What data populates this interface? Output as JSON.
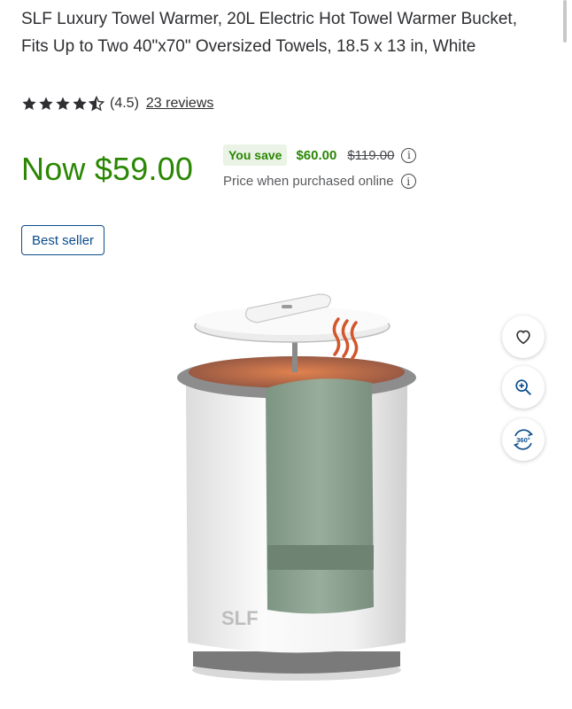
{
  "product": {
    "title": "SLF Luxury Towel Warmer, 20L Electric Hot Towel Warmer Bucket, Fits Up to Two 40\"x70\" Oversized Towels, 18.5 x 13 in, White",
    "rating_value": 4.5,
    "rating_text": "(4.5)",
    "reviews_link": "23 reviews",
    "badge": "Best seller",
    "brand_mark": "SLF"
  },
  "price": {
    "now": "Now $59.00",
    "you_save_label": "You save",
    "save_amount": "$60.00",
    "was_price": "$119.00",
    "online_note": "Price when purchased online"
  },
  "image_actions": [
    {
      "name": "favorite-button",
      "icon": "heart-icon"
    },
    {
      "name": "zoom-button",
      "icon": "zoom-in-icon"
    },
    {
      "name": "view-360-button",
      "icon": "360-view-icon",
      "label": "360°"
    }
  ],
  "colors": {
    "price_green": "#2a8703",
    "save_bg": "#eaf3e6",
    "badge_blue": "#0b4d8c",
    "text": "#2e2f32"
  }
}
